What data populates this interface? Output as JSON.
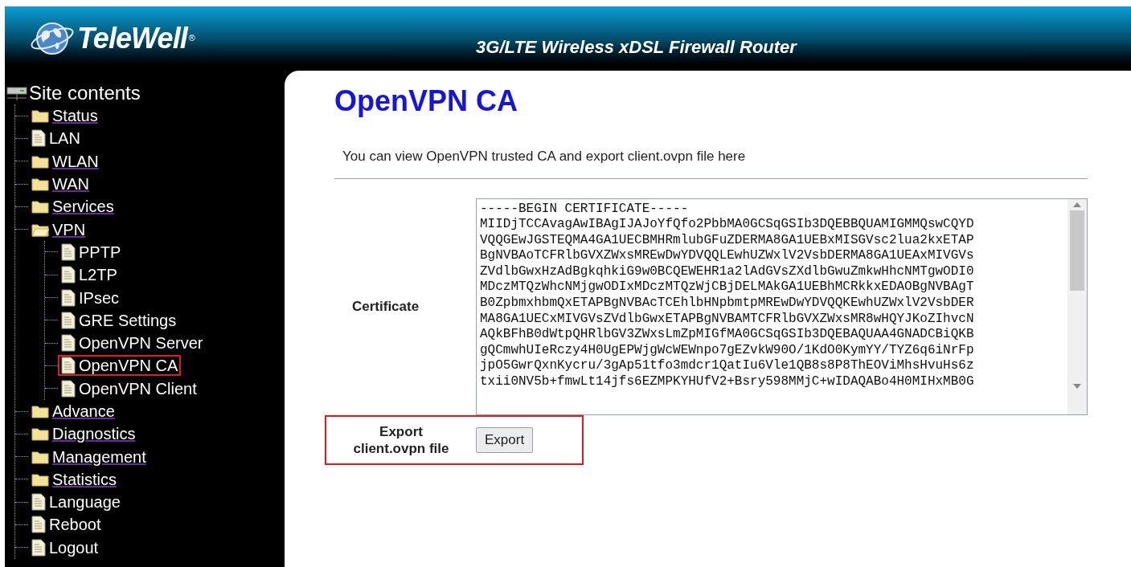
{
  "header": {
    "brand": "TeleWell",
    "registered": "®",
    "title": "3G/LTE Wireless xDSL Firewall Router"
  },
  "sidebar": {
    "title": "Site contents",
    "items": [
      {
        "label": "Status",
        "kind": "folder",
        "selected": false
      },
      {
        "label": "LAN",
        "kind": "page",
        "selected": false
      },
      {
        "label": "WLAN",
        "kind": "folder",
        "selected": false
      },
      {
        "label": "WAN",
        "kind": "folder",
        "selected": false
      },
      {
        "label": "Services",
        "kind": "folder",
        "selected": false
      },
      {
        "label": "VPN",
        "kind": "folder",
        "expanded": true,
        "selected": false,
        "children": [
          {
            "label": "PPTP",
            "kind": "page",
            "selected": false
          },
          {
            "label": "L2TP",
            "kind": "page",
            "selected": false
          },
          {
            "label": "IPsec",
            "kind": "page",
            "selected": false
          },
          {
            "label": "GRE Settings",
            "kind": "page",
            "selected": false
          },
          {
            "label": "OpenVPN Server",
            "kind": "page",
            "selected": false
          },
          {
            "label": "OpenVPN CA",
            "kind": "page",
            "selected": true
          },
          {
            "label": "OpenVPN Client",
            "kind": "page",
            "selected": false
          }
        ]
      },
      {
        "label": "Advance",
        "kind": "folder",
        "selected": false
      },
      {
        "label": "Diagnostics",
        "kind": "folder",
        "selected": false
      },
      {
        "label": "Management",
        "kind": "folder",
        "selected": false
      },
      {
        "label": "Statistics",
        "kind": "folder",
        "selected": false
      },
      {
        "label": "Language",
        "kind": "page",
        "selected": false
      },
      {
        "label": "Reboot",
        "kind": "page",
        "selected": false
      },
      {
        "label": "Logout",
        "kind": "page",
        "selected": false
      }
    ]
  },
  "page": {
    "title": "OpenVPN CA",
    "description": "You can view OpenVPN trusted CA and export client.ovpn file here",
    "certificate": {
      "label": "Certificate",
      "lines": [
        "-----BEGIN CERTIFICATE-----",
        "MIIDjTCCAvagAwIBAgIJAJoYfQfo2PbbMA0GCSqGSIb3DQEBBQUAMIGMMQswCQYD",
        "VQQGEwJGSTEQMA4GA1UECBMHRmlubGFuZDERMA8GA1UEBxMISGVsc2lua2kxETAP",
        "BgNVBAoTCFRlbGVXZWxsMREwDwYDVQQLEwhUZWxlV2VsbDERMA8GA1UEAxMIVGVs",
        "ZVdlbGwxHzAdBgkqhkiG9w0BCQEWEHR1a2lAdGVsZXdlbGwuZmkwHhcNMTgwODI0",
        "MDczMTQzWhcNMjgwODIxMDczMTQzWjCBjDELMAkGA1UEBhMCRkkxEDAOBgNVBAgT",
        "B0ZpbmxhbmQxETAPBgNVBAcTCEhlbHNpbmtpMREwDwYDVQQKEwhUZWxlV2VsbDER",
        "MA8GA1UECxMIVGVsZVdlbGwxETAPBgNVBAMTCFRlbGVXZWxsMR8wHQYJKoZIhvcN",
        "AQkBFhB0dWtpQHRlbGV3ZWxsLmZpMIGfMA0GCSqGSIb3DQEBAQUAA4GNADCBiQKB",
        "gQCmwhUIeRczy4H0UgEPWjgWcWEWnpo7gEZvkW90O/1KdO0KymYY/TYZ6q6iNrFp",
        "jpO5GwrQxnKycru/3gAp51tfo3mdcr1QatIu6Vle1QB8s8P8ThEOViMhsHvuHs6z",
        "txii0NV5b+fmwLt14jfs6EZMPKYHUfV2+Bsry598MMjC+wIDAQABo4H0MIHxMB0G"
      ]
    },
    "export": {
      "label_lines": [
        "Export",
        "client.ovpn file"
      ],
      "button": "Export",
      "highlighted": true
    }
  }
}
